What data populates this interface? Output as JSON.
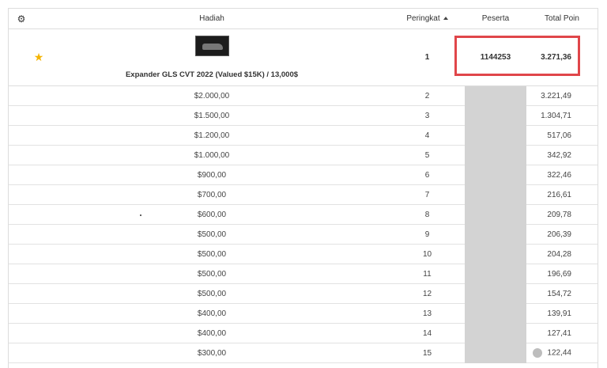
{
  "header": {
    "settings_icon": "gear-icon",
    "prize": "Hadiah",
    "rank": "Peringkat",
    "participants": "Peserta",
    "total_points": "Total Poin"
  },
  "top_entry": {
    "prize_image": "car-image",
    "prize_title": "Expander GLS CVT 2022 (Valued $15K) / 13,000$",
    "rank": "1",
    "participant": "1144253",
    "points": "3.271,36"
  },
  "rows": [
    {
      "prize": "$2.000,00",
      "rank": "2",
      "points": "3.221,49"
    },
    {
      "prize": "$1.500,00",
      "rank": "3",
      "points": "1.304,71"
    },
    {
      "prize": "$1.200,00",
      "rank": "4",
      "points": "517,06"
    },
    {
      "prize": "$1.000,00",
      "rank": "5",
      "points": "342,92"
    },
    {
      "prize": "$900,00",
      "rank": "6",
      "points": "322,46"
    },
    {
      "prize": "$700,00",
      "rank": "7",
      "points": "216,61"
    },
    {
      "prize": "$600,00",
      "rank": "8",
      "points": "209,78"
    },
    {
      "prize": "$500,00",
      "rank": "9",
      "points": "206,39"
    },
    {
      "prize": "$500,00",
      "rank": "10",
      "points": "204,28"
    },
    {
      "prize": "$500,00",
      "rank": "11",
      "points": "196,69"
    },
    {
      "prize": "$500,00",
      "rank": "12",
      "points": "154,72"
    },
    {
      "prize": "$400,00",
      "rank": "13",
      "points": "139,91"
    },
    {
      "prize": "$400,00",
      "rank": "14",
      "points": "127,41"
    },
    {
      "prize": "$300,00",
      "rank": "15",
      "points": "122,44"
    }
  ],
  "colors": {
    "highlight": "#e0464a",
    "star": "#f5b400",
    "redacted": "#d3d3d3"
  }
}
